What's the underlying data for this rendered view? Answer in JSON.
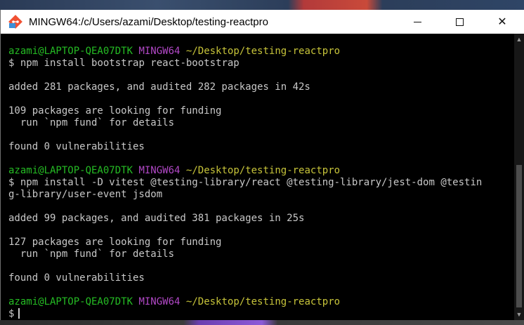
{
  "window": {
    "title": "MINGW64:/c/Users/azami/Desktop/testing-reactpro",
    "icon": "git-bash-icon",
    "controls": {
      "minimize": "minimize-icon",
      "maximize": "maximize-icon",
      "close": "✕"
    }
  },
  "terminal": {
    "colors": {
      "background": "#000000",
      "text": "#c8c8c8",
      "user_host": "#25bc24",
      "msystem": "#b148c6",
      "path": "#c7c43a"
    },
    "prompt": {
      "user_host": "azami@LAPTOP-QEA07DTK",
      "msystem": "MINGW64",
      "path": "~/Desktop/testing-reactpro",
      "symbol": "$"
    },
    "blocks": [
      {
        "command": "npm install bootstrap react-bootstrap",
        "output": [
          "",
          "added 281 packages, and audited 282 packages in 42s",
          "",
          "109 packages are looking for funding",
          "  run `npm fund` for details",
          "",
          "found 0 vulnerabilities",
          ""
        ]
      },
      {
        "command_line1": "npm install -D vitest @testing-library/react @testing-library/jest-dom @testin",
        "command_line2": "g-library/user-event jsdom",
        "output": [
          "",
          "added 99 packages, and audited 381 packages in 25s",
          "",
          "127 packages are looking for funding",
          "  run `npm fund` for details",
          "",
          "found 0 vulnerabilities",
          ""
        ]
      }
    ]
  }
}
